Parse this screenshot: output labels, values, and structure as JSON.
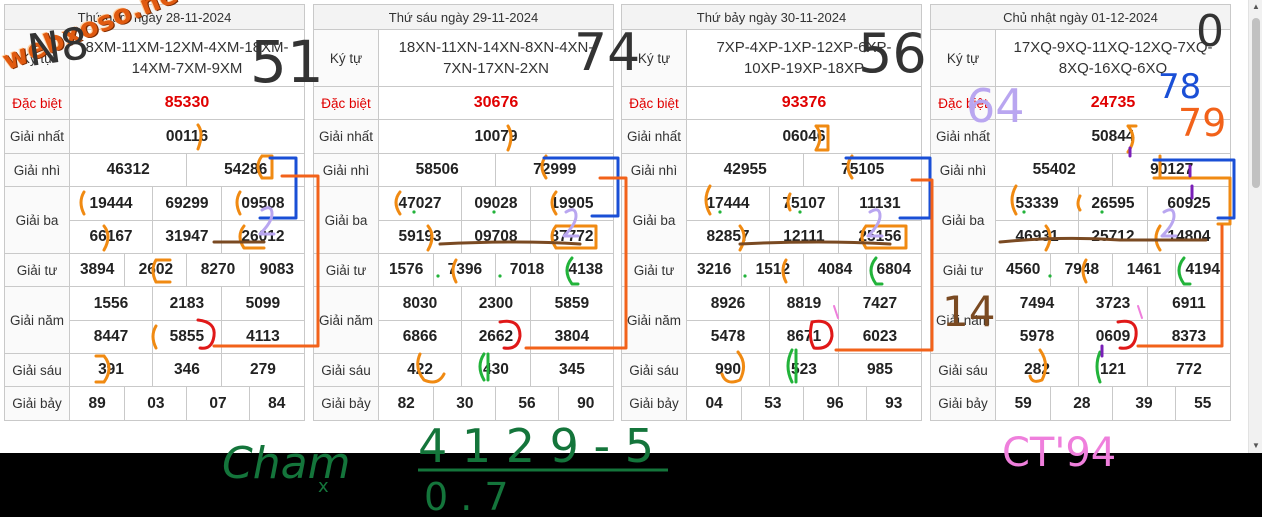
{
  "watermark": "webxoso.net",
  "labels": {
    "ky_tu": "Ký tự",
    "dac_biet": "Đặc biệt",
    "giai_nhat": "Giải nhất",
    "giai_nhi": "Giải nhì",
    "giai_ba": "Giải ba",
    "giai_tu": "Giải tư",
    "giai_nam": "Giải năm",
    "giai_sau": "Giải sáu",
    "giai_bay": "Giải bảy"
  },
  "days": [
    {
      "date": "Thứ năm ngày 28-11-2024",
      "ky_tu_1": "8XM-11XM-12XM-4XM-18XM-",
      "ky_tu_2": "14XM-7XM-9XM",
      "dac_biet": "85330",
      "nhat": "00116",
      "nhi": [
        "46312",
        "54286"
      ],
      "ba": [
        "19444",
        "69299",
        "09508",
        "66167",
        "31947",
        "26012"
      ],
      "tu": [
        "3894",
        "2602",
        "8270",
        "9083"
      ],
      "nam": [
        "1556",
        "2183",
        "5099",
        "8447",
        "5855",
        "4113"
      ],
      "sau": [
        "391",
        "346",
        "279"
      ],
      "bay": [
        "89",
        "03",
        "07",
        "84"
      ]
    },
    {
      "date": "Thứ sáu ngày 29-11-2024",
      "ky_tu_1": "18XN-11XN-14XN-8XN-4XN-",
      "ky_tu_2": "7XN-17XN-2XN",
      "dac_biet": "30676",
      "nhat": "10079",
      "nhi": [
        "58506",
        "72999"
      ],
      "ba": [
        "47027",
        "09028",
        "19905",
        "59193",
        "09708",
        "87772"
      ],
      "tu": [
        "1576",
        "7396",
        "7018",
        "4138"
      ],
      "nam": [
        "8030",
        "2300",
        "5859",
        "6866",
        "2662",
        "3804"
      ],
      "sau": [
        "422",
        "430",
        "345"
      ],
      "bay": [
        "82",
        "30",
        "56",
        "90"
      ]
    },
    {
      "date": "Thứ bảy ngày 30-11-2024",
      "ky_tu_1": "7XP-4XP-1XP-12XP-6XP-",
      "ky_tu_2": "10XP-19XP-18XP",
      "dac_biet": "93376",
      "nhat": "06046",
      "nhi": [
        "42955",
        "75105"
      ],
      "ba": [
        "17444",
        "75107",
        "11131",
        "82857",
        "12111",
        "25156"
      ],
      "tu": [
        "3216",
        "1512",
        "4084",
        "6804"
      ],
      "nam": [
        "8926",
        "8819",
        "7427",
        "5478",
        "8671",
        "6023"
      ],
      "sau": [
        "990",
        "523",
        "985"
      ],
      "bay": [
        "04",
        "53",
        "96",
        "93"
      ]
    },
    {
      "date": "Chủ nhật ngày 01-12-2024",
      "ky_tu_1": "17XQ-9XQ-11XQ-12XQ-7XQ-",
      "ky_tu_2": "8XQ-16XQ-6XQ",
      "dac_biet": "24735",
      "nhat": "50844",
      "nhi": [
        "55402",
        "90127"
      ],
      "ba": [
        "53339",
        "26595",
        "60925",
        "46931",
        "25712",
        "14804"
      ],
      "tu": [
        "4560",
        "7948",
        "1461",
        "4194"
      ],
      "nam": [
        "7494",
        "3723",
        "6911",
        "5978",
        "0609",
        "8373"
      ],
      "sau": [
        "282",
        "121",
        "772"
      ],
      "bay": [
        "59",
        "28",
        "39",
        "55"
      ]
    }
  ],
  "handwriting": {
    "top_nums": [
      "51",
      "74",
      "56"
    ],
    "d1_corner": "N8",
    "d4_corner": "0",
    "n64": "64",
    "n78": "78",
    "n79": "79",
    "n14": "14",
    "cham_word": "Cham",
    "cham_x": "x",
    "formula": "4 1 2 9 - 5",
    "formula_sub": "0 . 7",
    "ct": "CT'94"
  },
  "colors": {
    "orange": "#f08a12",
    "blue": "#1a4fd6",
    "green": "#22b33a",
    "red": "#e01818",
    "brown": "#7a4a22",
    "purple": "#7a1fb8",
    "lavender": "#b9a6f0",
    "pink": "#ef7fdc",
    "darkgreen": "#14753b",
    "dashed_blue": "#1fa0e0"
  }
}
